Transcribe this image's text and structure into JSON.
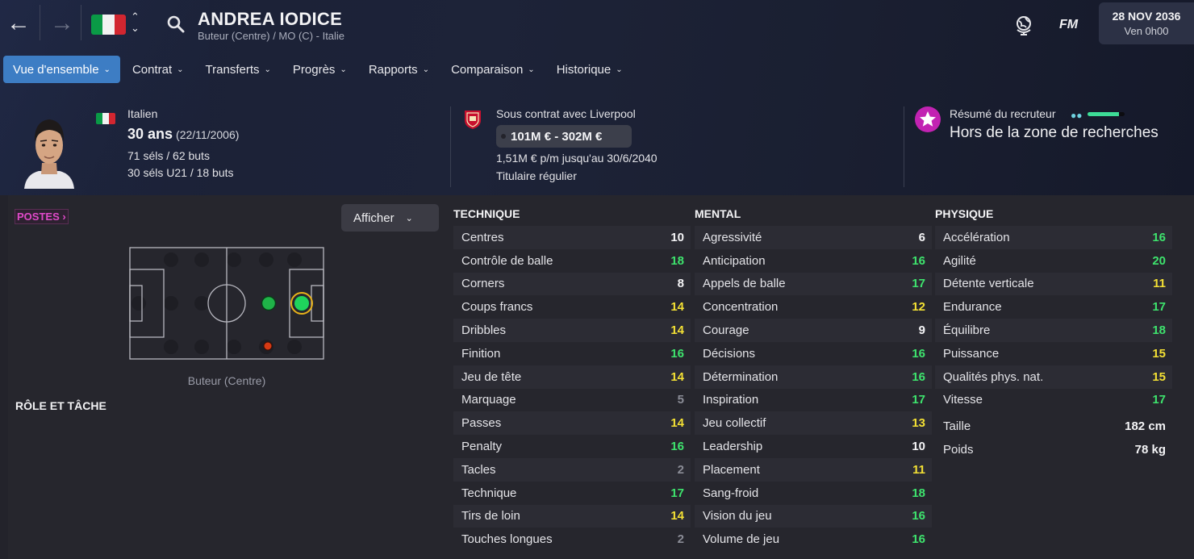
{
  "header": {
    "player_name": "ANDREA IODICE",
    "subtitle": "Buteur (Centre) / MO (C) - Italie",
    "logo_text": "FM",
    "date_line1": "28 NOV 2036",
    "date_line2": "Ven 0h00"
  },
  "tabs": [
    {
      "label": "Vue d'ensemble",
      "active": true
    },
    {
      "label": "Contrat"
    },
    {
      "label": "Transferts"
    },
    {
      "label": "Progrès"
    },
    {
      "label": "Rapports"
    },
    {
      "label": "Comparaison"
    },
    {
      "label": "Historique"
    }
  ],
  "info": {
    "nationality": "Italien",
    "age": "30 ans",
    "dob": "(22/11/2006)",
    "caps": "71 séls / 62 buts",
    "caps_u21": "30 séls U21 / 18 buts",
    "contract": "Sous contrat avec Liverpool",
    "value": "101M € - 302M €",
    "wage": "1,51M € p/m jusqu'au 30/6/2040",
    "squad_status": "Titulaire régulier",
    "scout_label": "Résumé du recruteur",
    "scout_level": 0.85,
    "scout_value": "Hors de la zone de recherches"
  },
  "positions": {
    "badge": "POSTES",
    "show_button": "Afficher",
    "position_label": "Buteur (Centre)",
    "role_title": "RÔLE ET TÂCHE"
  },
  "colors": {
    "accent": "#3d7dc4",
    "attr_green": "#3ee36d",
    "attr_yellow": "#f3e034",
    "attr_white": "#f4f4f6",
    "attr_grey": "#8a8c96",
    "postes_pink": "#e04ac9"
  },
  "icons": [
    "back-arrow-icon",
    "forward-arrow-icon",
    "italy-flag-icon",
    "search-icon",
    "globe-icon",
    "club-badge-icon",
    "star-icon",
    "binoculars-icon"
  ],
  "technique": {
    "title": "TECHNIQUE",
    "attrs": [
      {
        "name": "Centres",
        "value": "10",
        "color": "white"
      },
      {
        "name": "Contrôle de balle",
        "value": "18",
        "color": "green"
      },
      {
        "name": "Corners",
        "value": "8",
        "color": "white"
      },
      {
        "name": "Coups francs",
        "value": "14",
        "color": "yellow"
      },
      {
        "name": "Dribbles",
        "value": "14",
        "color": "yellow"
      },
      {
        "name": "Finition",
        "value": "16",
        "color": "green"
      },
      {
        "name": "Jeu de tête",
        "value": "14",
        "color": "yellow"
      },
      {
        "name": "Marquage",
        "value": "5",
        "color": "grey"
      },
      {
        "name": "Passes",
        "value": "14",
        "color": "yellow"
      },
      {
        "name": "Penalty",
        "value": "16",
        "color": "green"
      },
      {
        "name": "Tacles",
        "value": "2",
        "color": "grey"
      },
      {
        "name": "Technique",
        "value": "17",
        "color": "green"
      },
      {
        "name": "Tirs de loin",
        "value": "14",
        "color": "yellow"
      },
      {
        "name": "Touches longues",
        "value": "2",
        "color": "grey"
      }
    ]
  },
  "mental": {
    "title": "MENTAL",
    "attrs": [
      {
        "name": "Agressivité",
        "value": "6",
        "color": "white"
      },
      {
        "name": "Anticipation",
        "value": "16",
        "color": "green"
      },
      {
        "name": "Appels de balle",
        "value": "17",
        "color": "green"
      },
      {
        "name": "Concentration",
        "value": "12",
        "color": "yellow"
      },
      {
        "name": "Courage",
        "value": "9",
        "color": "white"
      },
      {
        "name": "Décisions",
        "value": "16",
        "color": "green"
      },
      {
        "name": "Détermination",
        "value": "16",
        "color": "green"
      },
      {
        "name": "Inspiration",
        "value": "17",
        "color": "green"
      },
      {
        "name": "Jeu collectif",
        "value": "13",
        "color": "yellow"
      },
      {
        "name": "Leadership",
        "value": "10",
        "color": "white"
      },
      {
        "name": "Placement",
        "value": "11",
        "color": "yellow"
      },
      {
        "name": "Sang-froid",
        "value": "18",
        "color": "green"
      },
      {
        "name": "Vision du jeu",
        "value": "16",
        "color": "green"
      },
      {
        "name": "Volume de jeu",
        "value": "16",
        "color": "green"
      }
    ]
  },
  "physique": {
    "title": "PHYSIQUE",
    "attrs": [
      {
        "name": "Accélération",
        "value": "16",
        "color": "green"
      },
      {
        "name": "Agilité",
        "value": "20",
        "color": "green"
      },
      {
        "name": "Détente verticale",
        "value": "11",
        "color": "yellow"
      },
      {
        "name": "Endurance",
        "value": "17",
        "color": "green"
      },
      {
        "name": "Équilibre",
        "value": "18",
        "color": "green"
      },
      {
        "name": "Puissance",
        "value": "15",
        "color": "yellow"
      },
      {
        "name": "Qualités phys. nat.",
        "value": "15",
        "color": "yellow"
      },
      {
        "name": "Vitesse",
        "value": "17",
        "color": "green"
      }
    ],
    "extra": [
      {
        "name": "Taille",
        "value": "182 cm"
      },
      {
        "name": "Poids",
        "value": "78 kg"
      }
    ]
  }
}
